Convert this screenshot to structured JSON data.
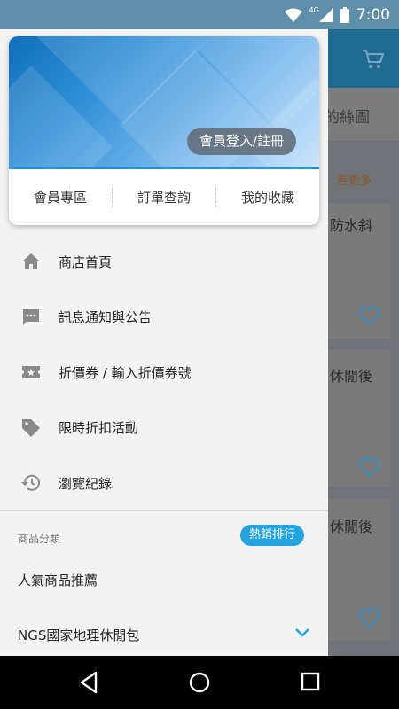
{
  "status_bar": {
    "time": "7:00",
    "network": "4G",
    "icons": [
      "wifi-icon",
      "signal-icon",
      "battery-icon"
    ]
  },
  "background_app": {
    "tab_partial": "的絲圖",
    "more_link": "看更多",
    "cards": [
      {
        "title_partial": "防水斜"
      },
      {
        "title_partial": "休閒後"
      },
      {
        "title_partial": "休閒後"
      }
    ]
  },
  "drawer": {
    "header": {
      "login_button": "會員登入/註冊",
      "quick_links": [
        "會員專區",
        "訂單查詢",
        "我的收藏"
      ]
    },
    "menu": [
      {
        "icon": "home-icon",
        "label": "商店首頁"
      },
      {
        "icon": "message-icon",
        "label": "訊息通知與公告"
      },
      {
        "icon": "coupon-icon",
        "label": "折價券 / 輸入折價券號"
      },
      {
        "icon": "tag-icon",
        "label": "限時折扣活動"
      },
      {
        "icon": "history-icon",
        "label": "瀏覽紀錄"
      }
    ],
    "categories": {
      "header": "商品分類",
      "badge": "熱銷排行",
      "items": [
        "人氣商品推薦",
        "NGS國家地理休閒包"
      ]
    }
  },
  "colors": {
    "accent": "#22a3e0",
    "status_bar": "#5f8ea9",
    "drawer_bg": "#f3f3f3"
  },
  "nav_bar": {
    "buttons": [
      "back-icon",
      "home-circle-icon",
      "recents-icon"
    ]
  }
}
